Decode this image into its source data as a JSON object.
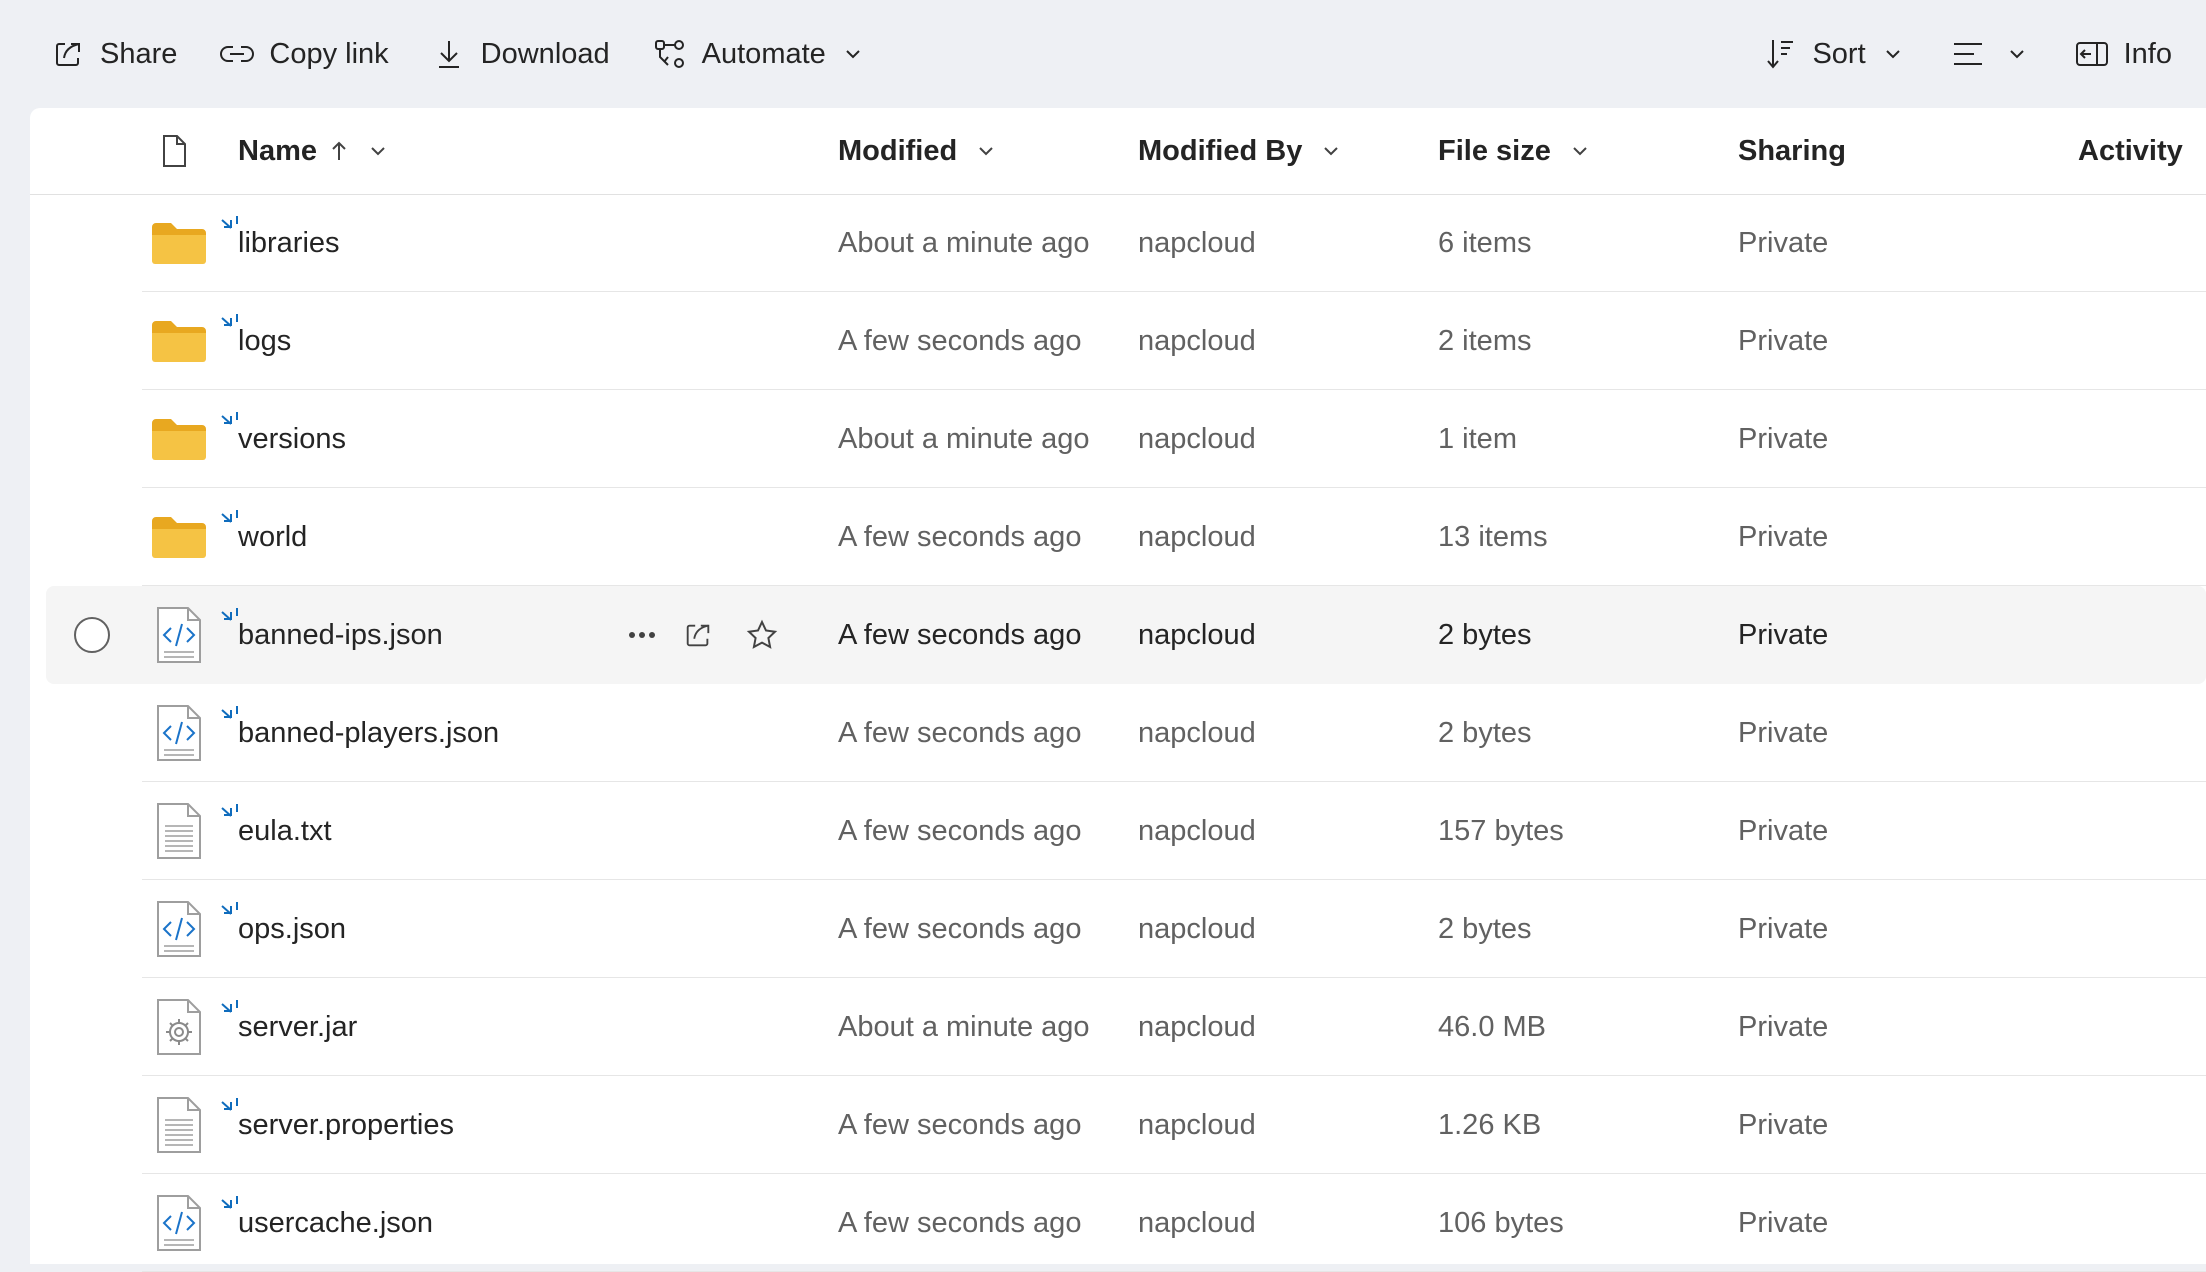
{
  "toolbar": {
    "share": "Share",
    "copy_link": "Copy link",
    "download": "Download",
    "automate": "Automate",
    "sort": "Sort",
    "info": "Info"
  },
  "columns": {
    "name": "Name",
    "modified": "Modified",
    "modified_by": "Modified By",
    "file_size": "File size",
    "sharing": "Sharing",
    "activity": "Activity"
  },
  "files": [
    {
      "name": "libraries",
      "type": "folder",
      "modified": "About a minute ago",
      "modified_by": "napcloud",
      "size": "6 items",
      "sharing": "Private"
    },
    {
      "name": "logs",
      "type": "folder",
      "modified": "A few seconds ago",
      "modified_by": "napcloud",
      "size": "2 items",
      "sharing": "Private"
    },
    {
      "name": "versions",
      "type": "folder",
      "modified": "About a minute ago",
      "modified_by": "napcloud",
      "size": "1 item",
      "sharing": "Private"
    },
    {
      "name": "world",
      "type": "folder",
      "modified": "A few seconds ago",
      "modified_by": "napcloud",
      "size": "13 items",
      "sharing": "Private"
    },
    {
      "name": "banned-ips.json",
      "type": "code",
      "modified": "A few seconds ago",
      "modified_by": "napcloud",
      "size": "2 bytes",
      "sharing": "Private",
      "selected": true
    },
    {
      "name": "banned-players.json",
      "type": "code",
      "modified": "A few seconds ago",
      "modified_by": "napcloud",
      "size": "2 bytes",
      "sharing": "Private"
    },
    {
      "name": "eula.txt",
      "type": "text",
      "modified": "A few seconds ago",
      "modified_by": "napcloud",
      "size": "157 bytes",
      "sharing": "Private"
    },
    {
      "name": "ops.json",
      "type": "code",
      "modified": "A few seconds ago",
      "modified_by": "napcloud",
      "size": "2 bytes",
      "sharing": "Private"
    },
    {
      "name": "server.jar",
      "type": "gear",
      "modified": "About a minute ago",
      "modified_by": "napcloud",
      "size": "46.0 MB",
      "sharing": "Private"
    },
    {
      "name": "server.properties",
      "type": "text",
      "modified": "A few seconds ago",
      "modified_by": "napcloud",
      "size": "1.26 KB",
      "sharing": "Private"
    },
    {
      "name": "usercache.json",
      "type": "code",
      "modified": "A few seconds ago",
      "modified_by": "napcloud",
      "size": "106 bytes",
      "sharing": "Private"
    }
  ],
  "colors": {
    "folder": "#f5c344",
    "accent": "#0f6cbd",
    "selected_row": "#f5f5f5"
  }
}
